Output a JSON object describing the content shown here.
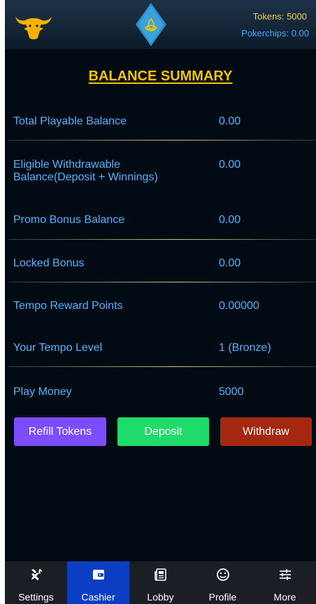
{
  "header": {
    "logo_icon": "bull-icon",
    "brand_icon": "triquetra-diamond-icon",
    "tokens_text": "Tokens: 5000",
    "pokerchips_text": "Pokerchips: 0.00"
  },
  "title": "BALANCE SUMMARY",
  "rows": [
    {
      "label": "Total Playable Balance",
      "value": "0.00"
    },
    {
      "label_line1": "Eligible Withdrawable",
      "label_line2": "Balance(Deposit + Winnings)",
      "value": "0.00"
    },
    {
      "label": "Promo Bonus Balance",
      "value": "0.00"
    },
    {
      "label": "Locked Bonus",
      "value": "0.00"
    },
    {
      "label": "Tempo Reward Points",
      "value": "0.00000"
    },
    {
      "label": "Your Tempo Level",
      "value": "1 (Bronze)"
    },
    {
      "label": "Play Money",
      "value": "5000"
    }
  ],
  "buttons": {
    "refill": "Refill Tokens",
    "deposit": "Deposit",
    "withdraw": "Withdraw"
  },
  "nav": {
    "active": "Cashier",
    "items": [
      {
        "label": "Settings",
        "icon": "tools-icon"
      },
      {
        "label": "Cashier",
        "icon": "wallet-icon"
      },
      {
        "label": "Lobby",
        "icon": "newspaper-icon"
      },
      {
        "label": "Profile",
        "icon": "smiley-icon"
      },
      {
        "label": "More",
        "icon": "sliders-icon"
      }
    ]
  },
  "colors": {
    "accent_gold": "#f2c300",
    "text_blue": "#4fb3ff",
    "refill_purple": "#7b4dff",
    "deposit_green": "#1fdb6a",
    "withdraw_red": "#a3280f",
    "nav_active_blue": "#0b3ec2"
  }
}
